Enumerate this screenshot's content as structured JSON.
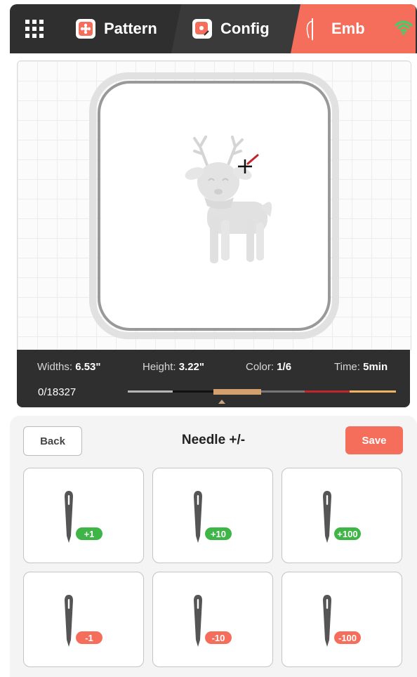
{
  "nav": {
    "tabs": [
      {
        "label": "Pattern",
        "icon": "flower-card-icon"
      },
      {
        "label": "Config",
        "icon": "edit-flower-icon"
      },
      {
        "label": "Emb",
        "icon": "needle-thread-icon",
        "active": true
      }
    ],
    "menu_icon": "grid-menu-icon",
    "status_icon": "wifi-icon",
    "active_color": "#f56e5c",
    "wifi_color": "#39d46b"
  },
  "info": {
    "width_label": "Widths:",
    "width_value": "6.53\"",
    "height_label": "Height:",
    "height_value": "3.22\"",
    "color_label": "Color:",
    "color_value": "1/6",
    "time_label": "Time:",
    "time_value": "5min",
    "stitch_counter": "0/18327",
    "thread_colors": [
      "#b5b5b5",
      "#111111",
      "#d4a06e",
      "#777777",
      "#c0262b",
      "#f0b460"
    ],
    "active_thread_index": 2
  },
  "controls": {
    "back_label": "Back",
    "title": "Needle +/-",
    "save_label": "Save",
    "save_color": "#f56e5c"
  },
  "needle_buttons": [
    {
      "label": "+1",
      "color": "#3fb447"
    },
    {
      "label": "+10",
      "color": "#3fb447"
    },
    {
      "label": "+100",
      "color": "#3fb447"
    },
    {
      "label": "-1",
      "color": "#f56e5c"
    },
    {
      "label": "-10",
      "color": "#f56e5c"
    },
    {
      "label": "-100",
      "color": "#f56e5c"
    }
  ]
}
